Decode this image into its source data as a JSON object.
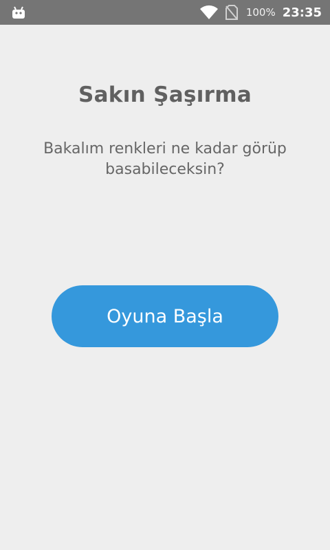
{
  "status_bar": {
    "notification_icon": "android-icon",
    "wifi_icon": "wifi-icon",
    "sim_icon": "no-sim-icon",
    "battery": "100%",
    "time": "23:35"
  },
  "screen": {
    "title": "Sakın Şaşırma",
    "subtitle": "Bakalım renkleri ne kadar görüp basabileceksin?",
    "start_button_label": "Oyuna Başla",
    "button_color": "#3598dc",
    "background_color": "#eeeeee"
  }
}
